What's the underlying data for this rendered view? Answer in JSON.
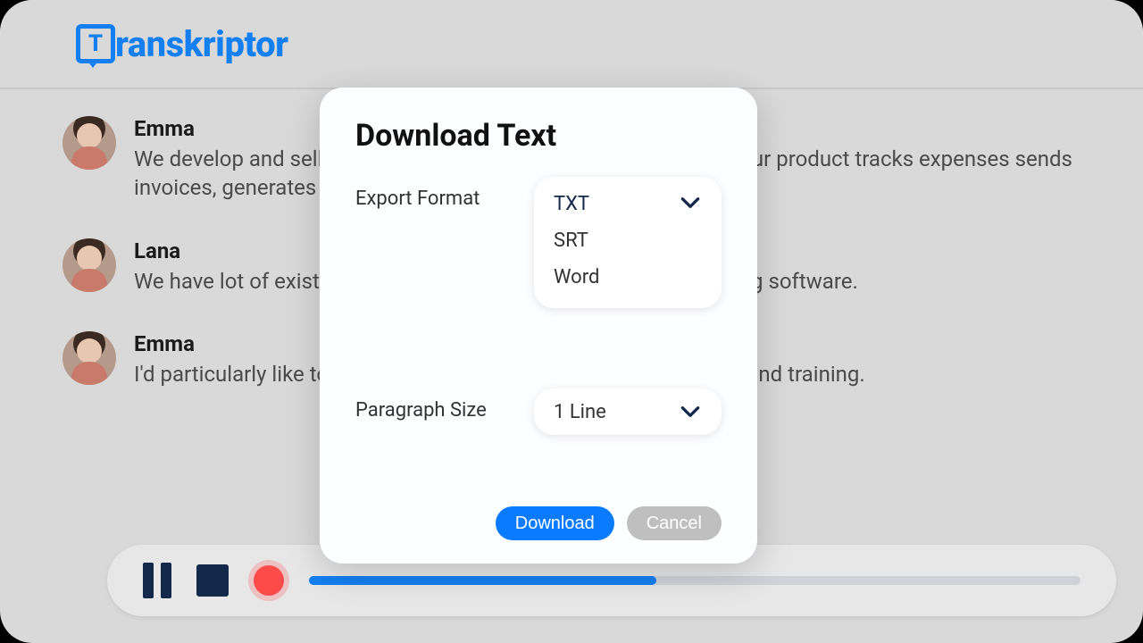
{
  "brand": {
    "name": "ranskriptor",
    "letter": "T"
  },
  "transcript": [
    {
      "speaker": "Emma",
      "text": "We develop and sell accounting software for small businesses. Our product tracks expenses sends invoices, generates reports and so on."
    },
    {
      "speaker": "Lana",
      "text": "We have lot of existing customers who already use our accounting software."
    },
    {
      "speaker": "Emma",
      "text": "I'd particularly like to ask you about the experience after the sale and training."
    }
  ],
  "modal": {
    "title": "Download Text",
    "exportFormat": {
      "label": "Export Format",
      "options": [
        "TXT",
        "SRT",
        "Word"
      ],
      "selected": "TXT"
    },
    "paragraphSize": {
      "label": "Paragraph Size",
      "selected": "1 Line"
    },
    "actions": {
      "primary": "Download",
      "secondary": "Cancel"
    }
  },
  "player": {
    "progress": 45
  },
  "colors": {
    "accent": "#137ff1",
    "dark": "#13284a",
    "record": "#ff4a4a"
  }
}
